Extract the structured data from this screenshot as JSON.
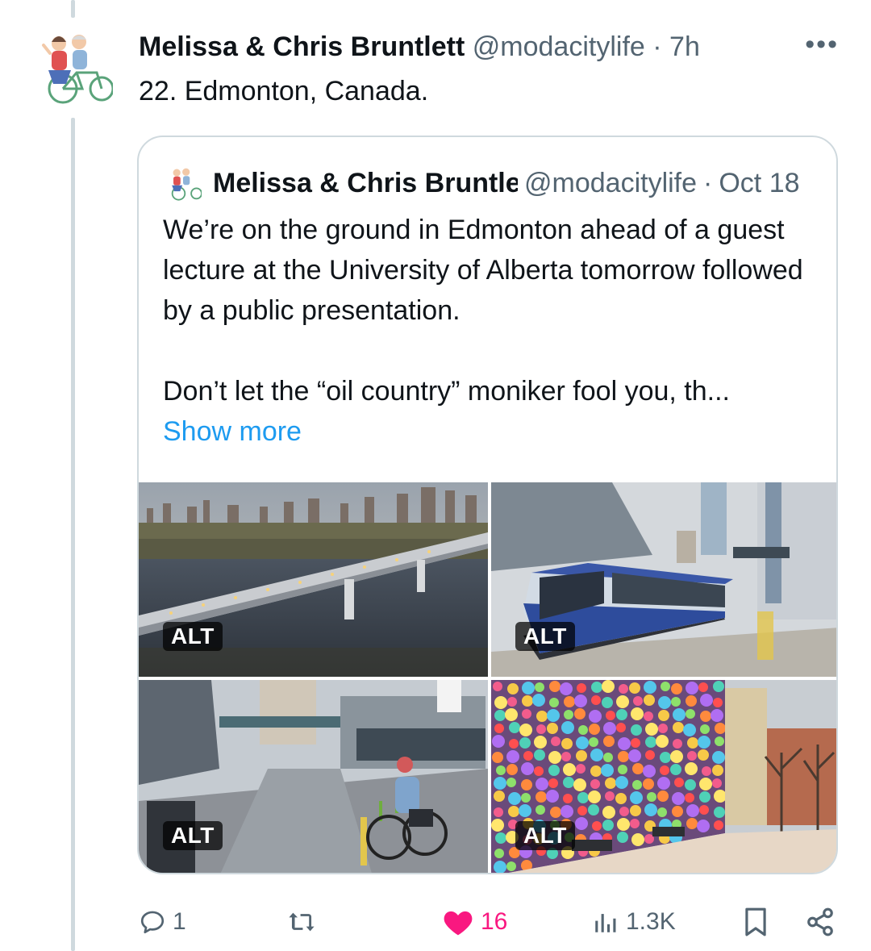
{
  "tweet": {
    "author_name": "Melissa & Chris Bruntlett",
    "handle": "@modacitylife",
    "separator": "·",
    "time": "7h",
    "more_label": "•••",
    "text": "22. Edmonton, Canada."
  },
  "quote": {
    "author_name": "Melissa & Chris Bruntlett",
    "handle": "@modacitylife",
    "separator": "·",
    "time": "Oct 18",
    "para1": "We’re on the ground in Edmonton ahead of a guest lecture at the University of Alberta tomorrow followed by a public presentation.",
    "para2": "Don’t let the “oil country” moniker fool you, th...",
    "show_more": "Show more",
    "media": [
      {
        "alt_badge": "ALT",
        "subject": "pedestrian bridge over river with skyline"
      },
      {
        "alt_badge": "ALT",
        "subject": "light rail train at station"
      },
      {
        "alt_badge": "ALT",
        "subject": "protected bike lane with cyclist"
      },
      {
        "alt_badge": "ALT",
        "subject": "colorful dotted mural wall"
      }
    ]
  },
  "actions": {
    "replies": "1",
    "reposts": "",
    "likes": "16",
    "views": "1.3K"
  },
  "colors": {
    "text": "#0f1419",
    "muted": "#536471",
    "link": "#1d9bf0",
    "like": "#f91880",
    "border": "#cfd9de"
  },
  "icons": [
    "reply-icon",
    "repost-icon",
    "like-icon",
    "views-icon",
    "bookmark-icon",
    "share-icon",
    "more-icon"
  ]
}
